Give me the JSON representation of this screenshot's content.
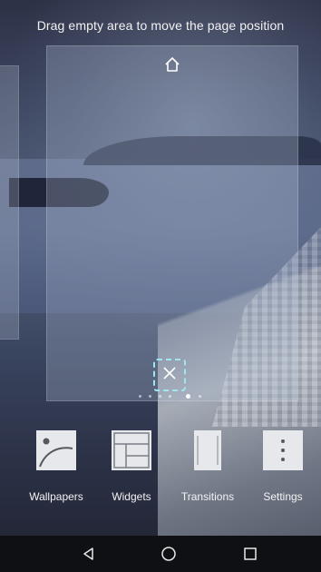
{
  "hint": {
    "text": "Drag empty area to move the page position"
  },
  "page": {
    "home_icon": "home-icon",
    "delete_icon": "close-icon"
  },
  "page_indicator": {
    "count": 6,
    "active_index": 4
  },
  "toolbar": {
    "items": [
      {
        "label": "Wallpapers",
        "icon": "wallpaper-icon"
      },
      {
        "label": "Widgets",
        "icon": "widgets-icon"
      },
      {
        "label": "Transitions",
        "icon": "transitions-icon"
      },
      {
        "label": "Settings",
        "icon": "settings-icon"
      }
    ]
  },
  "navbar": {
    "back_icon": "back-icon",
    "home_icon": "home-circle-icon",
    "recents_icon": "recents-icon"
  },
  "colors": {
    "delete_border": "#9fe7ef",
    "navbar_bg": "#0f1014",
    "tool_icon_bg": "#e6e8ec"
  }
}
